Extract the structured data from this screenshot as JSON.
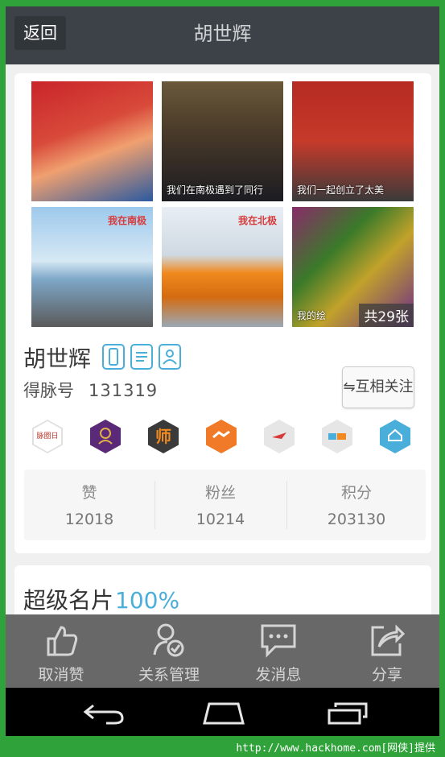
{
  "header": {
    "back_label": "返回",
    "title": "胡世辉"
  },
  "photos": [
    {
      "caption": "",
      "tag": ""
    },
    {
      "caption": "我们在南极遇到了同行",
      "tag": ""
    },
    {
      "caption": "我们一起创立了太美",
      "tag": ""
    },
    {
      "caption": "",
      "tag": "我在南极"
    },
    {
      "caption": "",
      "tag": "我在北极"
    },
    {
      "caption": "我的绘",
      "tag": ""
    }
  ],
  "photo_count": "共29张",
  "profile": {
    "name": "胡世辉",
    "id_label": "得脉号",
    "id_value": "131319",
    "follow_label": "⇋互相关注"
  },
  "medals": [
    {
      "icon": "diary-medal-icon",
      "text": "脉圈日志"
    },
    {
      "icon": "person-medal-icon",
      "text": ""
    },
    {
      "icon": "teacher-medal-icon",
      "text": "师"
    },
    {
      "icon": "handshake-medal-icon",
      "text": ""
    },
    {
      "icon": "brand-medal-icon",
      "text": ""
    },
    {
      "icon": "mobile-medal-icon",
      "text": ""
    },
    {
      "icon": "expert-medal-icon",
      "text": ""
    }
  ],
  "stats": [
    {
      "label": "赞",
      "value": "12018"
    },
    {
      "label": "粉丝",
      "value": "10214"
    },
    {
      "label": "积分",
      "value": "203130"
    }
  ],
  "card": {
    "title": "超级名片",
    "percent": "100%"
  },
  "actions": [
    {
      "icon": "thumbs-up-icon",
      "label": "取消赞"
    },
    {
      "icon": "relation-manage-icon",
      "label": "关系管理"
    },
    {
      "icon": "message-icon",
      "label": "发消息"
    },
    {
      "icon": "share-icon",
      "label": "分享"
    }
  ],
  "footer_text": "http://www.hackhome.com[网侠]提供",
  "colors": {
    "accent": "#4aaedb",
    "topbar": "#3c4247",
    "frame": "#2fa33a"
  }
}
